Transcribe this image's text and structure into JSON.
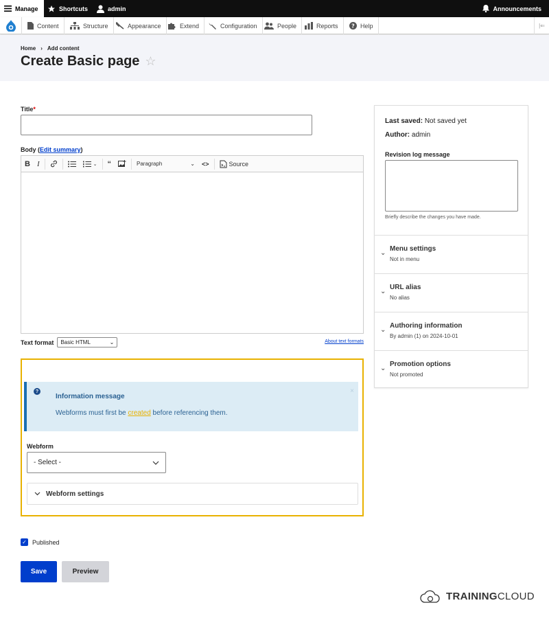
{
  "toolbar": {
    "manage": "Manage",
    "shortcuts": "Shortcuts",
    "user": "admin",
    "announcements": "Announcements"
  },
  "admin_menu": {
    "items": [
      "Content",
      "Structure",
      "Appearance",
      "Extend",
      "Configuration",
      "People",
      "Reports",
      "Help"
    ]
  },
  "header": {
    "breadcrumb": [
      "Home",
      "Add content"
    ],
    "title": "Create Basic page"
  },
  "form": {
    "title_label": "Title",
    "title_value": "",
    "body_label": "Body",
    "edit_summary": "Edit summary",
    "editor": {
      "paragraph_format": "Paragraph",
      "source_label": "Source"
    },
    "text_format_label": "Text format",
    "text_format_value": "Basic HTML",
    "about_text_formats": "About text formats"
  },
  "webform": {
    "info_title": "Information message",
    "info_text_before": "Webforms must first be",
    "info_link": "created",
    "info_text_after": "before referencing them.",
    "label": "Webform",
    "select_value": "- Select -",
    "settings_label": "Webform settings"
  },
  "published": {
    "label": "Published",
    "checked": true
  },
  "actions": {
    "save": "Save",
    "preview": "Preview"
  },
  "sidebar": {
    "last_saved_label": "Last saved:",
    "last_saved_value": "Not saved yet",
    "author_label": "Author:",
    "author_value": "admin",
    "revision_label": "Revision log message",
    "revision_help": "Briefly describe the changes you have made.",
    "sections": [
      {
        "title": "Menu settings",
        "summary": "Not in menu"
      },
      {
        "title": "URL alias",
        "summary": "No alias"
      },
      {
        "title": "Authoring information",
        "summary": "By admin (1) on 2024-10-01"
      },
      {
        "title": "Promotion options",
        "summary": "Not promoted"
      }
    ]
  },
  "brand": {
    "bold": "TRAINING",
    "light": "CLOUD"
  },
  "colors": {
    "primary": "#003ecc",
    "highlight": "#e8b100",
    "info_bg": "#dcecf5"
  }
}
